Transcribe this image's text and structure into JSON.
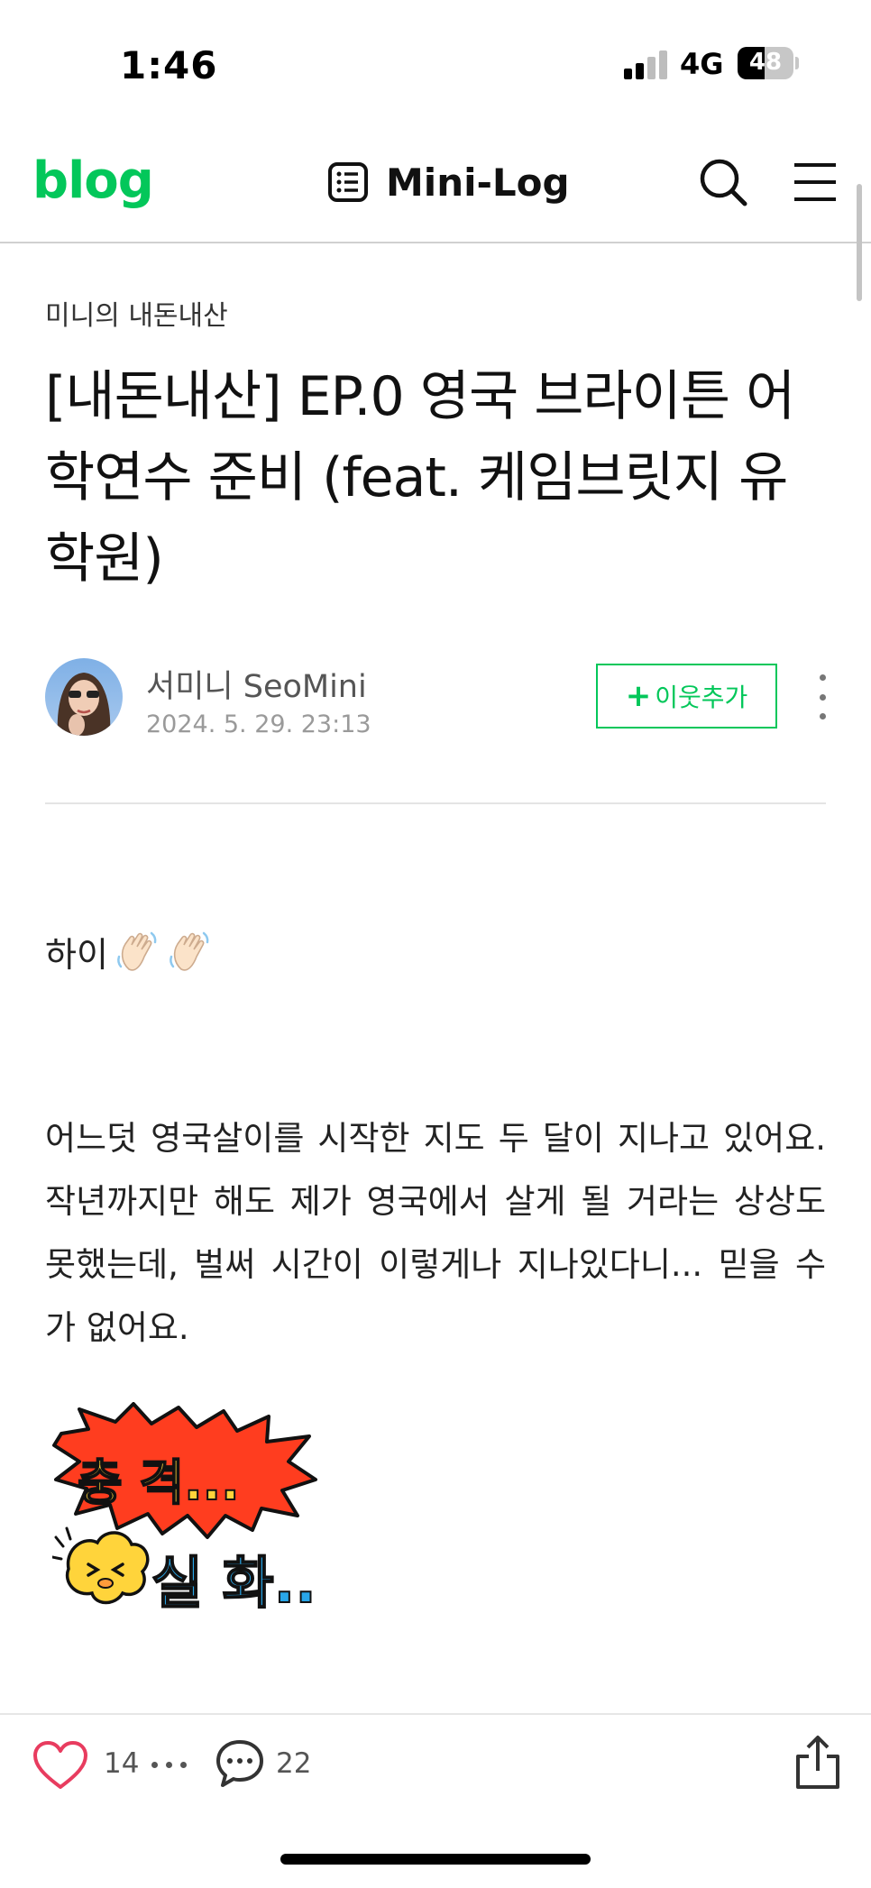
{
  "status": {
    "time": "1:46",
    "network": "4G",
    "battery": "48",
    "battery_level": 0.48
  },
  "header": {
    "logo": "blog",
    "title": "Mini-Log",
    "icons": [
      "list-icon",
      "search-icon",
      "hamburger-menu-icon"
    ]
  },
  "post": {
    "category": "미니의 내돈내산",
    "title": "[내돈내산] EP.0 영국 브라이튼 어학연수 준비 (feat. 케임브릿지 유학원)",
    "author": "서미니 SeoMini",
    "date": "2024. 5. 29. 23:13",
    "follow_plus": "+",
    "follow_label": "이웃추가",
    "greeting": "하이",
    "greeting_emoji": [
      "waving-hand-icon",
      "waving-hand-icon"
    ],
    "paragraph": "어느덧 영국살이를 시작한 지도 두 달이 지나고 있어요. 작년까지만 해도 제가 영국에서 살게 될 거라는 상상도 못했는데, 벌써 시간이 이렇게나 지나있다니... 믿을 수가 없어요.",
    "sticker": {
      "line1": "충 격...",
      "line2": "실 화..",
      "icon": "shocked-chick-sticker"
    }
  },
  "bottom_bar": {
    "likes": "14",
    "comments": "22",
    "icons": [
      "heart-icon",
      "more-dots-icon",
      "comment-icon",
      "share-icon"
    ]
  },
  "colors": {
    "accent": "#03c75a",
    "like": "#e83c5f",
    "sticker_red": "#ff3d1f",
    "sticker_blue": "#29a6e8",
    "sticker_yellow": "#ffd43b"
  }
}
